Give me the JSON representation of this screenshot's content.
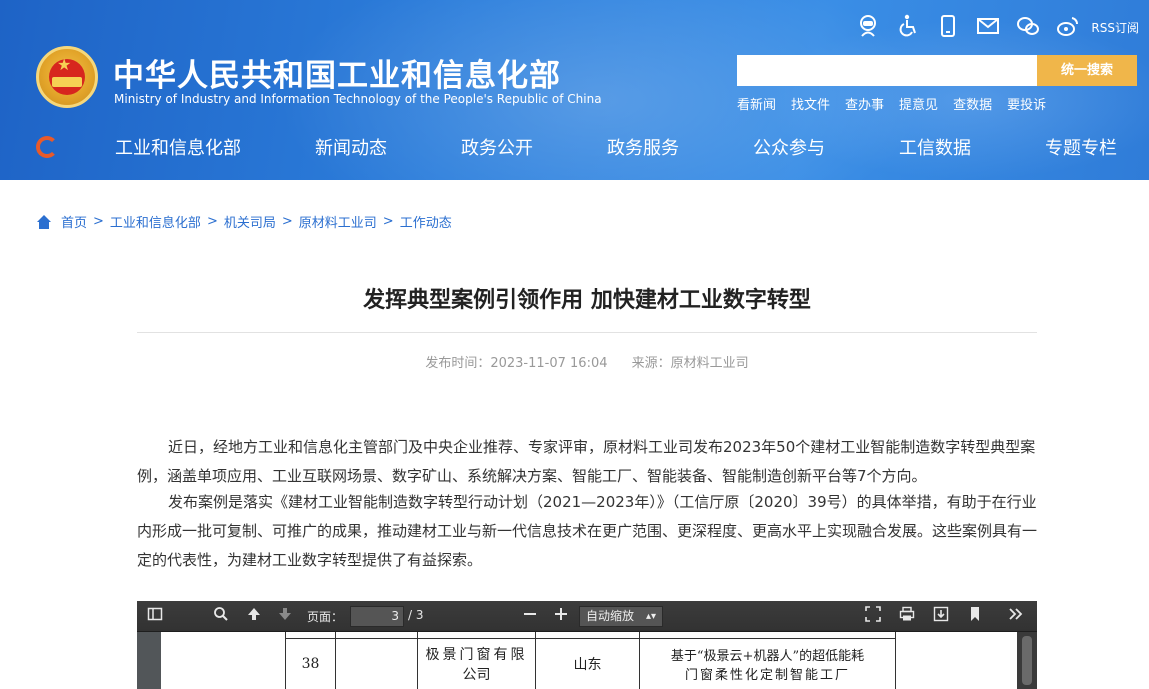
{
  "header": {
    "site_title": "中华人民共和国工业和信息化部",
    "site_subtitle": "Ministry of Industry and Information Technology of the People's Republic of China",
    "rss_label": "RSS订阅",
    "search": {
      "placeholder": "",
      "button": "统一搜索"
    },
    "quick_links": [
      "看新闻",
      "找文件",
      "查办事",
      "提意见",
      "查数据",
      "要投诉"
    ]
  },
  "nav": {
    "items": [
      "工业和信息化部",
      "新闻动态",
      "政务公开",
      "政务服务",
      "公众参与",
      "工信数据",
      "专题专栏"
    ]
  },
  "breadcrumb": [
    "首页",
    "工业和信息化部",
    "机关司局",
    "原材料工业司",
    "工作动态"
  ],
  "article": {
    "title": "发挥典型案例引领作用 加快建材工业数字转型",
    "publish_time": "发布时间：2023-11-07 16:04",
    "source": "来源：原材料工业司",
    "paragraphs": [
      "近日，经地方工业和信息化主管部门及中央企业推荐、专家评审，原材料工业司发布2023年50个建材工业智能制造数字转型典型案例，涵盖单项应用、工业互联网场景、数字矿山、系统解决方案、智能工厂、智能装备、智能制造创新平台等7个方向。",
      "发布案例是落实《建材工业智能制造数字转型行动计划（2021—2023年）》（工信厅原〔2020〕39号）的具体举措，有助于在行业内形成一批可复制、可推广的成果，推动建材工业与新一代信息技术在更广范围、更深程度、更高水平上实现融合发展。这些案例具有一定的代表性，为建材工业数字转型提供了有益探索。"
    ]
  },
  "pdf_viewer": {
    "page_label": "页面：",
    "current_page": "3",
    "total_pages": "/ 3",
    "zoom": "自动缩放",
    "table_row": {
      "number": "38",
      "company_line1": "极景门窗有限",
      "company_line2": "公司",
      "province": "山东",
      "case_line1": "基于“极景云+机器人”的超低能耗",
      "case_line2": "门窗柔性化定制智能工厂"
    }
  }
}
